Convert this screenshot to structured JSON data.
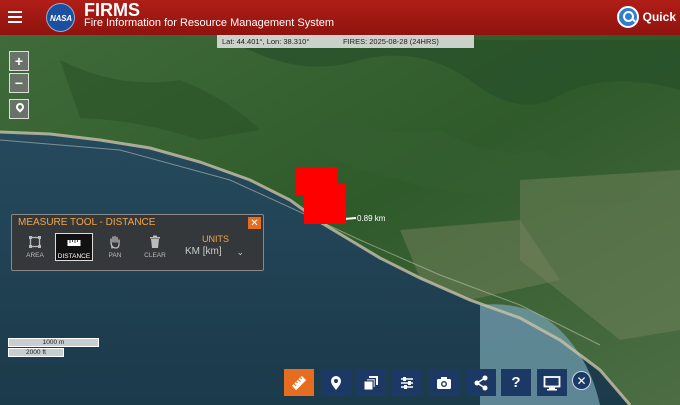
{
  "header": {
    "app_name": "FIRMS",
    "subtitle": "Fire Information for Resource Management System",
    "logo_text": "NASA",
    "quick_label": "Quick"
  },
  "coordinates": {
    "latlon": "Lat: 44.401°, Lon: 38.310°",
    "fires": "FIRES: 2025-08-28 (24HRS)"
  },
  "map_controls": {
    "zoom_in": "+",
    "zoom_out": "−",
    "locate_icon": "map-pin-icon"
  },
  "measure": {
    "distance_label": "0.89 km"
  },
  "measure_tool": {
    "title": "MEASURE TOOL - DISTANCE",
    "close": "✕",
    "tools": [
      {
        "label": "AREA",
        "icon": "area-icon"
      },
      {
        "label": "DISTANCE",
        "icon": "ruler-icon",
        "active": true
      },
      {
        "label": "PAN",
        "icon": "hand-icon"
      },
      {
        "label": "CLEAR",
        "icon": "trash-icon"
      }
    ],
    "units_label": "UNITS",
    "units_value": "KM [km]",
    "units_chevron": "⌄"
  },
  "scale": {
    "metric": "1000 m",
    "imperial": "2000 ft"
  },
  "toolbar": {
    "items": [
      {
        "name": "measure",
        "icon": "ruler-icon",
        "active": true
      },
      {
        "name": "location",
        "icon": "map-pin-icon"
      },
      {
        "name": "layers",
        "icon": "layers-icon"
      },
      {
        "name": "filters",
        "icon": "sliders-icon"
      },
      {
        "name": "snapshot",
        "icon": "camera-icon"
      },
      {
        "name": "share",
        "icon": "share-icon"
      },
      {
        "name": "help",
        "icon": "help-icon",
        "text": "?"
      },
      {
        "name": "display",
        "icon": "monitor-icon"
      }
    ],
    "close": "✕"
  },
  "colors": {
    "header": "#a8180f",
    "fire": "#ff0000",
    "accent": "#e66d1f",
    "toolbar": "#1c3966",
    "measure_title": "#f2a64a"
  }
}
